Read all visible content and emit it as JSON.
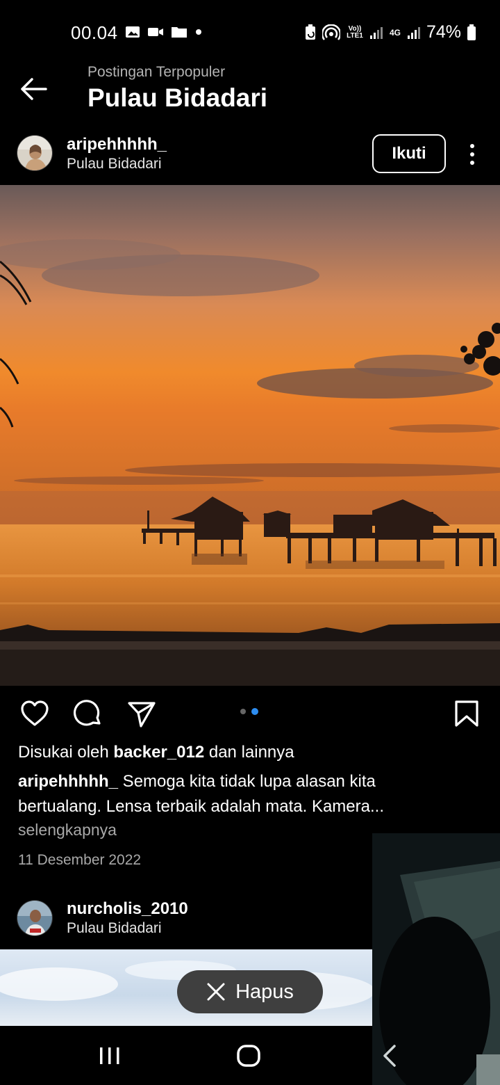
{
  "status_bar": {
    "time": "00.04",
    "network_label_1": "Vo)) LTE1",
    "network_label_2": "4G",
    "battery": "74%"
  },
  "header": {
    "subtitle": "Postingan Terpopuler",
    "title": "Pulau Bidadari"
  },
  "post1": {
    "username": "aripehhhhh_",
    "location": "Pulau Bidadari",
    "follow_label": "Ikuti",
    "likes_prefix": "Disukai oleh ",
    "likes_user": "backer_012",
    "likes_suffix": " dan lainnya",
    "caption_user": "aripehhhhh_",
    "caption_text": " Semoga kita tidak lupa alasan kita bertualang. Lensa terbaik adalah mata. Kamera...",
    "more_label": "selengkapnya",
    "date": "11 Desember 2022",
    "carousel_count": 2,
    "carousel_active_index": 1
  },
  "post2": {
    "username": "nurcholis_2010",
    "location": "Pulau Bidadari"
  },
  "toast": {
    "label": "Hapus"
  },
  "icons": {
    "back": "arrow-left-icon",
    "more": "more-vertical-icon",
    "like": "heart-icon",
    "comment": "comment-icon",
    "share": "send-icon",
    "save": "bookmark-icon",
    "close": "close-icon",
    "nav_recent": "recent-apps-icon",
    "nav_home": "home-icon",
    "nav_back": "chevron-left-icon"
  },
  "colors": {
    "background": "#000000",
    "accent_dot": "#2d8df0",
    "secondary_text": "#a8a8a8"
  }
}
